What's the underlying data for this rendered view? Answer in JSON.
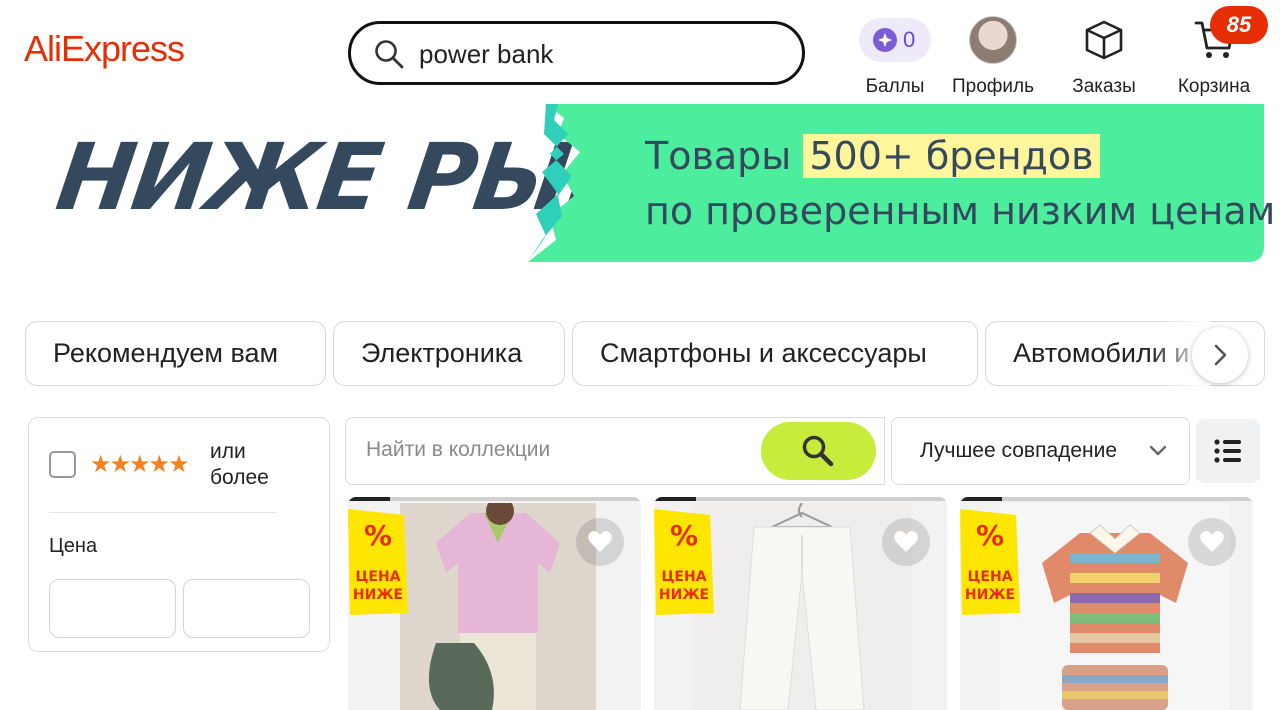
{
  "header": {
    "logo": "AliExpress",
    "search": {
      "value": "power bank"
    },
    "bonus": {
      "count": "0",
      "label": "Баллы"
    },
    "profile": {
      "label": "Профиль"
    },
    "orders": {
      "label": "Заказы"
    },
    "cart": {
      "label": "Корзина",
      "badge": "85"
    }
  },
  "banner": {
    "headline": "НИЖЕ РЫНКА",
    "line1_prefix": "Товары",
    "line1_highlight": "500+ брендов",
    "line2": "по проверенным низким ценам"
  },
  "categories": [
    "Рекомендуем вам",
    "Электроника",
    "Смартфоны и аксессуары",
    "Автомобили и"
  ],
  "filters": {
    "rating_stars": "★★★★★",
    "rating_text_1": "или",
    "rating_text_2": "более",
    "price_label": "Цена"
  },
  "collection": {
    "search_placeholder": "Найти в коллекции",
    "sort_label": "Лучшее совпадение"
  },
  "promo": {
    "percent": "%",
    "line1": "ЦЕНА",
    "line2": "НИЖЕ"
  },
  "colors": {
    "brand": "#e62e04",
    "banner_green": "#4cee9d",
    "search_button": "#c7ec3c",
    "banner_text": "#34495e"
  }
}
